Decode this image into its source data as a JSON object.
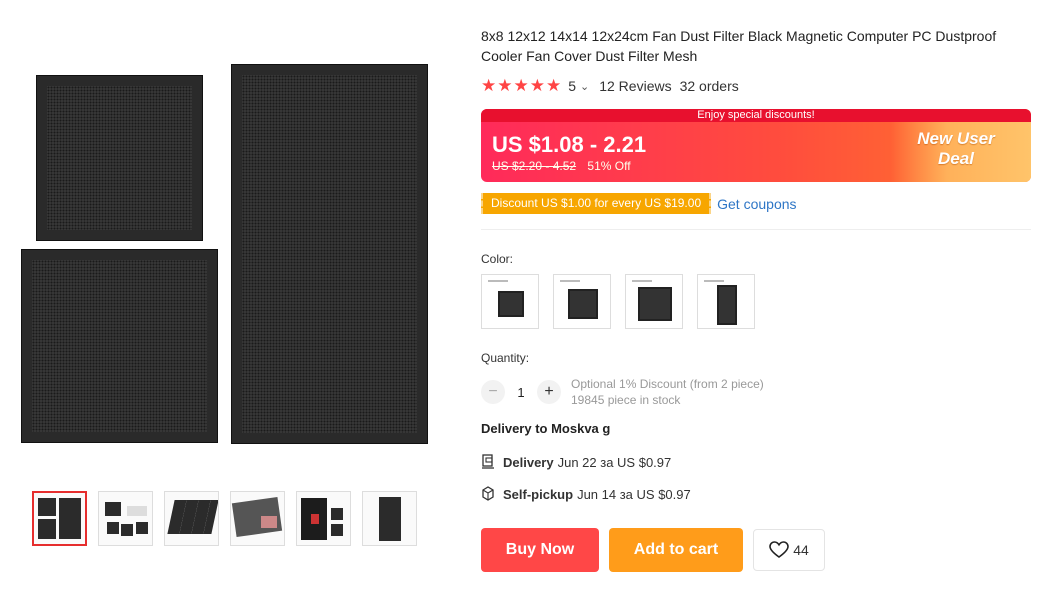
{
  "product": {
    "title": "8x8 12x12 14x14 12x24cm Fan Dust Filter Black Magnetic Computer PC Dustproof Cooler Fan Cover Dust Filter Mesh",
    "rating": "5",
    "stars": "★★★★★",
    "reviews": "12 Reviews",
    "orders": "32 orders"
  },
  "promo": {
    "banner": "Enjoy special discounts!",
    "price": "US $1.08 - 2.21",
    "old_price": "US $2.20 - 4.52",
    "discount": "51% Off",
    "badge": "New User Deal"
  },
  "coupon": {
    "tag": "Discount US $1.00 for every US $19.00",
    "link": "Get coupons"
  },
  "color": {
    "label": "Color:"
  },
  "quantity": {
    "label": "Quantity:",
    "minus": "−",
    "value": "1",
    "plus": "+",
    "note_line1": "Optional 1% Discount (from 2 piece)",
    "note_line2": "19845 piece in stock"
  },
  "delivery": {
    "heading": "Delivery to Moskva g",
    "row1_label": "Delivery",
    "row1_text": "Jun 22 за US $0.97",
    "row2_label": "Self-pickup",
    "row2_text": "Jun 14 за US $0.97"
  },
  "actions": {
    "buy": "Buy Now",
    "cart": "Add to cart",
    "wishlist_count": "44"
  },
  "colors": {
    "accent": "#ff4747",
    "cart": "#ff9c1a",
    "coupon": "#f7a600",
    "link": "#2e76c6",
    "star": "#ff4444"
  }
}
